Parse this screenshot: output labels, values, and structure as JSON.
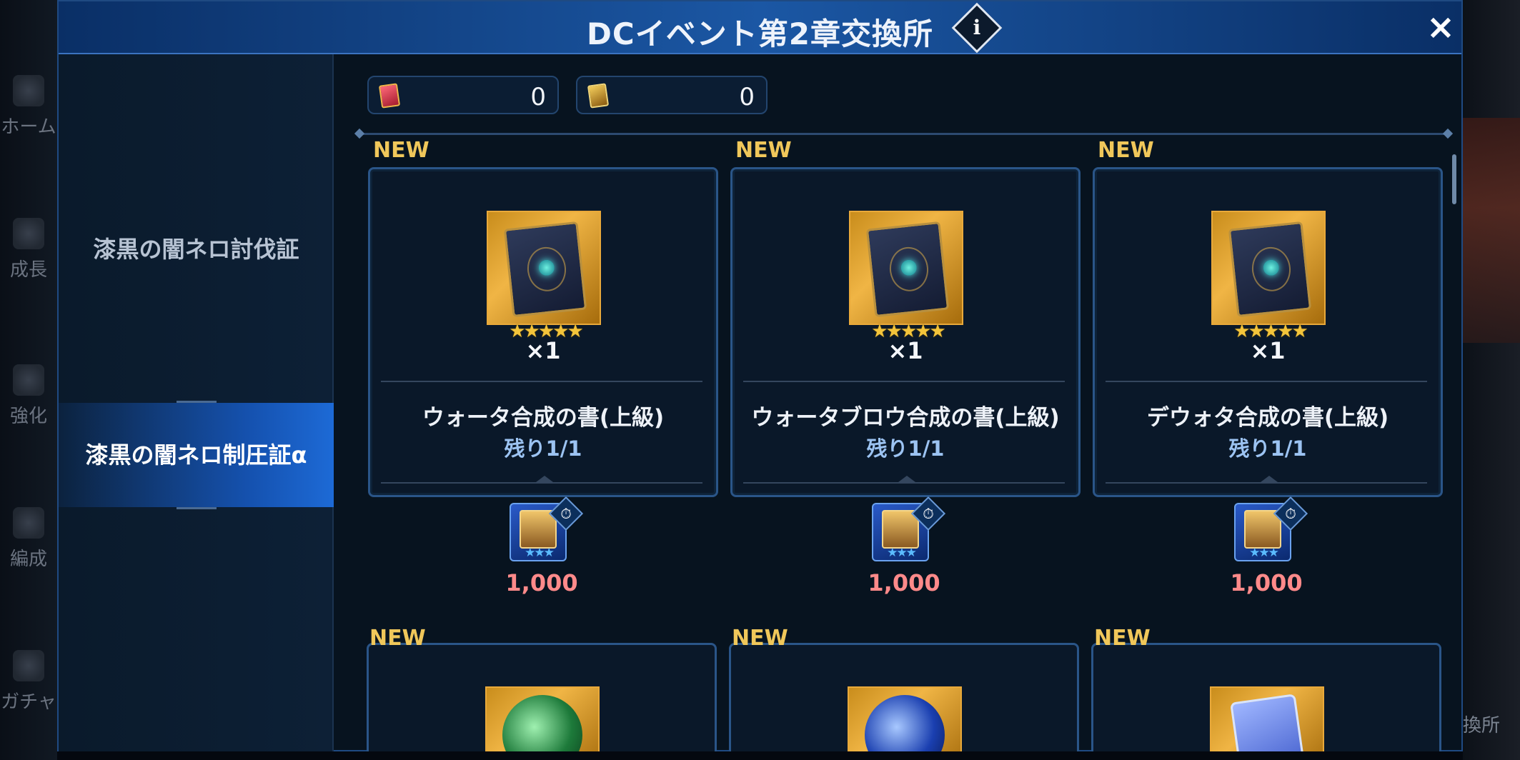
{
  "background_nav": {
    "items": [
      {
        "label": "ホーム",
        "icon": "home-icon"
      },
      {
        "label": "成長",
        "icon": "growth-icon"
      },
      {
        "label": "強化",
        "icon": "enhance-icon"
      },
      {
        "label": "編成",
        "icon": "party-icon"
      },
      {
        "label": "ガチャ",
        "icon": "gacha-icon"
      }
    ],
    "right_label": "換所"
  },
  "modal": {
    "title": "DCイベント第2章交換所",
    "info_icon": "i",
    "close_icon": "×"
  },
  "sidebar": {
    "items": [
      {
        "label": "漆黒の闇ネロ討伐証",
        "active": false
      },
      {
        "label": "漆黒の闇ネロ制圧証α",
        "active": true
      }
    ]
  },
  "currencies": [
    {
      "icon": "red-ticket-icon",
      "color": "#d0364a",
      "value": "0"
    },
    {
      "icon": "gold-ticket-icon",
      "color": "#d7a431",
      "value": "0"
    }
  ],
  "shop": {
    "items": [
      {
        "badge": "NEW",
        "name": "ウォータ合成の書(上級)",
        "rarity": "★★★★★",
        "quantity": "×1",
        "remaining": "残り1/1",
        "cost_icon_stars": "★★★",
        "timer_icon": "⏱",
        "cost": "1,000"
      },
      {
        "badge": "NEW",
        "name": "ウォータブロウ合成の書(上級)",
        "rarity": "★★★★★",
        "quantity": "×1",
        "remaining": "残り1/1",
        "cost_icon_stars": "★★★",
        "timer_icon": "⏱",
        "cost": "1,000"
      },
      {
        "badge": "NEW",
        "name": "デウォタ合成の書(上級)",
        "rarity": "★★★★★",
        "quantity": "×1",
        "remaining": "残り1/1",
        "cost_icon_stars": "★★★",
        "timer_icon": "⏱",
        "cost": "1,000"
      },
      {
        "badge": "NEW",
        "art": "green-orb-icon"
      },
      {
        "badge": "NEW",
        "art": "blue-orb-icon"
      },
      {
        "badge": "NEW",
        "art": "blue-card-icon"
      }
    ]
  },
  "colors": {
    "title_bar": "#1b57a4",
    "new_badge": "#f0c75a",
    "cost": "#ff8a8a",
    "remaining": "#9cc3f2",
    "active_tab": "#1d6ad6"
  }
}
